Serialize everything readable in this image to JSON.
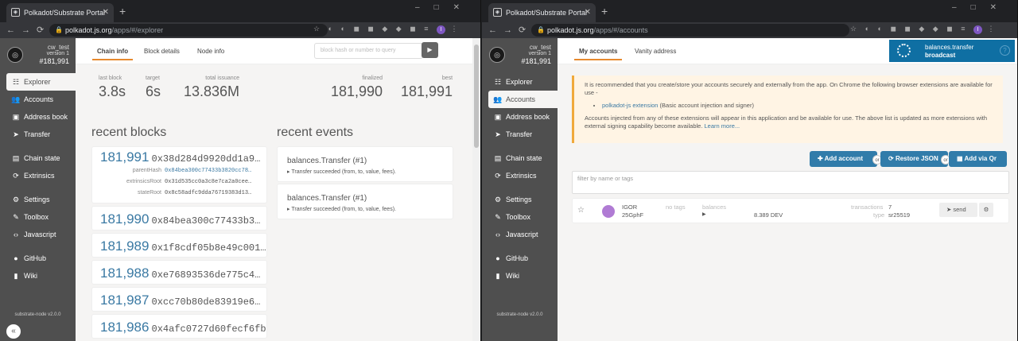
{
  "left": {
    "browser": {
      "tab_title": "Polkadot/Substrate Portal",
      "url_host": "polkadot.js.org",
      "url_path": "/apps/#/explorer"
    },
    "sidebar": {
      "node_name": "cw_test",
      "node_version": "version 1",
      "block": "#181,991",
      "items": [
        "Explorer",
        "Accounts",
        "Address book",
        "Transfer",
        "Chain state",
        "Extrinsics",
        "Settings",
        "Toolbox",
        "Javascript",
        "GitHub",
        "Wiki"
      ],
      "footer": "substrate-node v2.0.0"
    },
    "tabs": [
      "Chain info",
      "Block details",
      "Node info"
    ],
    "search_placeholder": "block hash or number to query",
    "stats": {
      "last_block_label": "last block",
      "last_block": "3.8s",
      "target_label": "target",
      "target": "6s",
      "issuance_label": "total issuance",
      "issuance": "13.836M",
      "finalized_label": "finalized",
      "finalized": "181,990",
      "best_label": "best",
      "best": "181,991"
    },
    "recent_blocks_title": "recent blocks",
    "recent_events_title": "recent events",
    "blocks": [
      {
        "num": "181,991",
        "hash": "0x38d284d9920dd1a9…",
        "parent_label": "parentHash",
        "parent": "0x84bea300c77433b3820cc78…",
        "extr_label": "extrinsicsRoot",
        "extr": "0x31d535cc0a3c8e7ca2a0cee…",
        "state_label": "stateRoot",
        "state": "0x8c58adfc9dda76719383d13…"
      },
      {
        "num": "181,990",
        "hash": "0x84bea300c77433b3…"
      },
      {
        "num": "181,989",
        "hash": "0x1f8cdf05b8e49c001…"
      },
      {
        "num": "181,988",
        "hash": "0xe76893536de775c4…"
      },
      {
        "num": "181,987",
        "hash": "0xcc70b80de83919e6…"
      },
      {
        "num": "181,986",
        "hash": "0x4afc0727d60fecf6fb…"
      }
    ],
    "events": [
      {
        "title": "balances.Transfer (#1)",
        "desc": "Transfer succeeded (from, to, value, fees)."
      },
      {
        "title": "balances.Transfer (#1)",
        "desc": "Transfer succeeded (from, to, value, fees)."
      }
    ]
  },
  "right": {
    "browser": {
      "tab_title": "Polkadot/Substrate Portal",
      "url_host": "polkadot.js.org",
      "url_path": "/apps/#/accounts"
    },
    "tabs": [
      "My accounts",
      "Vanity address"
    ],
    "broadcast": {
      "line1": "balances.transfer",
      "line2": "broadcast"
    },
    "warning": {
      "p1": "It is recommended that you create/store your accounts securely and externally from the app. On Chrome the following browser extensions are available for use -",
      "ext_link": "polkadot-js extension",
      "ext_desc": " (Basic account injection and signer)",
      "p2": "Accounts injected from any of these extensions will appear in this application and be available for use. The above list is updated as more extensions with external signing capability become available. ",
      "learn": "Learn more..."
    },
    "buttons": {
      "add": "Add account",
      "restore": "Restore JSON",
      "qr": "Add via Qr",
      "or": "or"
    },
    "filter_placeholder": "filter by name or tags",
    "account": {
      "name": "IGOR",
      "addr": "25GphF",
      "tags": "no tags",
      "balances_label": "balances",
      "balance": "8.389 DEV",
      "tx_label": "transactions",
      "tx": "7",
      "type_label": "type",
      "type": "sr25519",
      "send": "send"
    }
  }
}
